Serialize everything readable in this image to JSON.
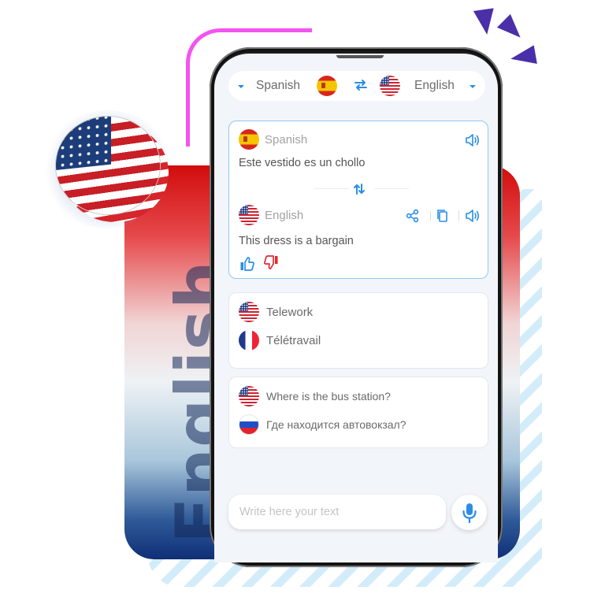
{
  "background": {
    "vertical_word": "English",
    "accent_colors": {
      "pink_arc": "#f453f1",
      "sparks": "#4b2fa8",
      "stripes": "#d3ecfa",
      "panel_top": "#d20c0c",
      "panel_bottom": "#0f2f77"
    },
    "coin_flag": "us-flag"
  },
  "language_bar": {
    "source_language": "Spanish",
    "source_flag": "es-flag",
    "target_language": "English",
    "target_flag": "us-flag",
    "swap_icon": "swap-arrows-icon",
    "dropdown_icon": "caret-down-icon"
  },
  "translation_card": {
    "source": {
      "language": "Spanish",
      "flag": "es-flag",
      "text": "Este vestido es un chollo",
      "actions": [
        "speaker-icon"
      ]
    },
    "swap_icon": "swap-vertical-icon",
    "target": {
      "language": "English",
      "flag": "us-flag",
      "text": "This dress is a bargain",
      "actions": [
        "share-icon",
        "copy-icon",
        "speaker-icon"
      ]
    },
    "feedback": [
      "thumbs-up-icon",
      "thumbs-down-icon"
    ]
  },
  "phrase_cards": [
    {
      "rows": [
        {
          "flag": "us-flag",
          "text": "Telework"
        },
        {
          "flag": "fr-flag",
          "text": "Télétravail"
        }
      ]
    },
    {
      "rows": [
        {
          "flag": "us-flag",
          "text": "Where is the bus station?"
        },
        {
          "flag": "ru-flag",
          "text": "Где находится автовокзал?"
        }
      ]
    }
  ],
  "input": {
    "placeholder": "Write here your text",
    "value": "",
    "mic_icon": "microphone-icon"
  },
  "colors": {
    "accent": "#2a8de6",
    "dislike": "#e0282e",
    "screen_bg": "#f2f5f9",
    "card_border_active": "#8fc9f2"
  }
}
